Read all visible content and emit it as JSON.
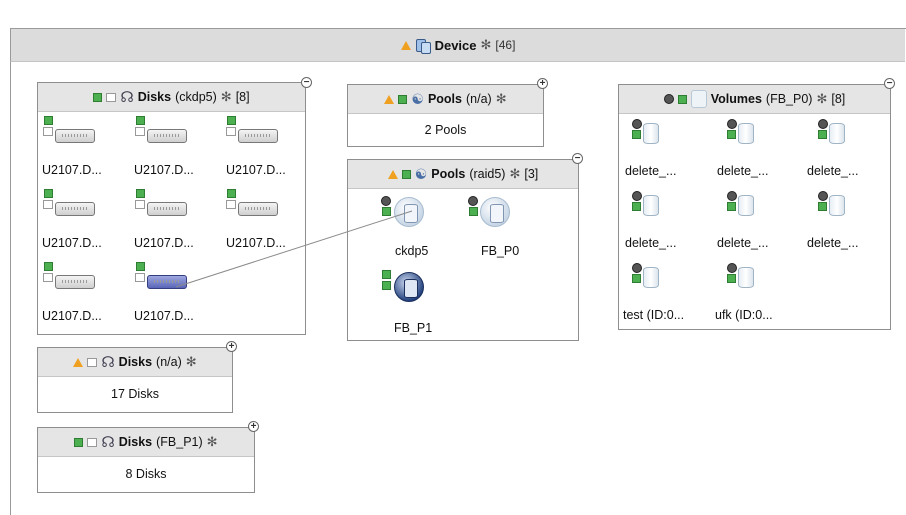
{
  "device": {
    "title": "Device",
    "count": "[46]"
  },
  "panels": {
    "disks_ckdp5": {
      "title": "Disks",
      "qualifier": "(ckdp5)",
      "count": "[8]",
      "items": [
        "U2107.D...",
        "U2107.D...",
        "U2107.D...",
        "U2107.D...",
        "U2107.D...",
        "U2107.D...",
        "U2107.D...",
        "U2107.D..."
      ]
    },
    "pools_na": {
      "title": "Pools",
      "qualifier": "(n/a)",
      "summary": "2 Pools"
    },
    "pools_raid5": {
      "title": "Pools",
      "qualifier": "(raid5)",
      "count": "[3]",
      "items": [
        "ckdp5",
        "FB_P0",
        "FB_P1"
      ]
    },
    "volumes_fb_p0": {
      "title": "Volumes",
      "qualifier": "(FB_P0)",
      "count": "[8]",
      "items": [
        "delete_...",
        "delete_...",
        "delete_...",
        "delete_...",
        "delete_...",
        "delete_...",
        "test (ID:0...",
        "ufk (ID:0..."
      ]
    },
    "disks_na": {
      "title": "Disks",
      "qualifier": "(n/a)",
      "summary": "17 Disks"
    },
    "disks_fb_p1": {
      "title": "Disks",
      "qualifier": "(FB_P1)",
      "summary": "8 Disks"
    }
  },
  "icons": {
    "collapse": "−",
    "expand": "+",
    "filter": "✻"
  },
  "colors": {
    "header_bg": "#e5e5e5",
    "device_bar_bg": "#dcdcdc",
    "status_ok": "#4caf50",
    "status_warning": "#f0a020",
    "selected_disk": "#5966b8"
  }
}
